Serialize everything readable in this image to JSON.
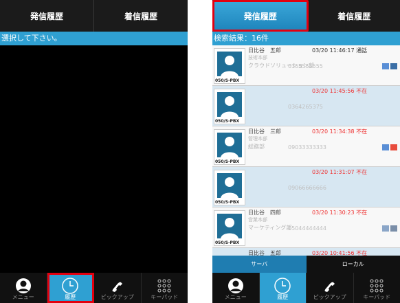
{
  "left": {
    "tabs": [
      "発信履歴",
      "着信履歴"
    ],
    "prompt": "選択して下さい。",
    "nav": [
      {
        "label": "メニュー",
        "icon": "user-icon"
      },
      {
        "label": "履歴",
        "icon": "clock-icon"
      },
      {
        "label": "ピックアップ",
        "icon": "phone-icon"
      },
      {
        "label": "キーパッド",
        "icon": "keypad-icon"
      }
    ]
  },
  "right": {
    "tabs": [
      "発信履歴",
      "着信履歴"
    ],
    "result_count": "検索結果：16件",
    "avatar_tag": "050/S-PBX",
    "rows": [
      {
        "name": "日比谷　五郎",
        "line2": "技術本部",
        "line3": "クラウドソリューション部",
        "number": "0355555555",
        "time": "03/20 11:46:17",
        "status": "通話"
      },
      {
        "name": "",
        "line2": "",
        "line3": "",
        "number": "0364265375",
        "time": "03/20 11:45:56",
        "status": "不在"
      },
      {
        "name": "日比谷　三郎",
        "line2": "管理本部",
        "line3": "総務部",
        "number": "09033333333",
        "time": "03/20 11:34:38",
        "status": "不在"
      },
      {
        "name": "",
        "line2": "",
        "line3": "",
        "number": "09066666666",
        "time": "03/20 11:31:07",
        "status": "不在"
      },
      {
        "name": "日比谷　四郎",
        "line2": "営業本部",
        "line3": "マーケティング部",
        "number": "05044444444",
        "time": "03/20 11:30:23",
        "status": "不在"
      },
      {
        "name": "日比谷　五郎",
        "line2": "",
        "line3": "",
        "number": "",
        "time": "03/20 10:41:56",
        "status": "不在"
      }
    ],
    "server_tabs": [
      "サーバ",
      "ローカル"
    ],
    "nav": [
      {
        "label": "メニュー",
        "icon": "user-icon"
      },
      {
        "label": "履歴",
        "icon": "clock-icon"
      },
      {
        "label": "ピックアップ",
        "icon": "phone-icon"
      },
      {
        "label": "キーパッド",
        "icon": "keypad-icon"
      }
    ]
  },
  "colors": {
    "accent": "#2fa0d2",
    "highlight": "#e3000f",
    "missed": "#e33333"
  }
}
